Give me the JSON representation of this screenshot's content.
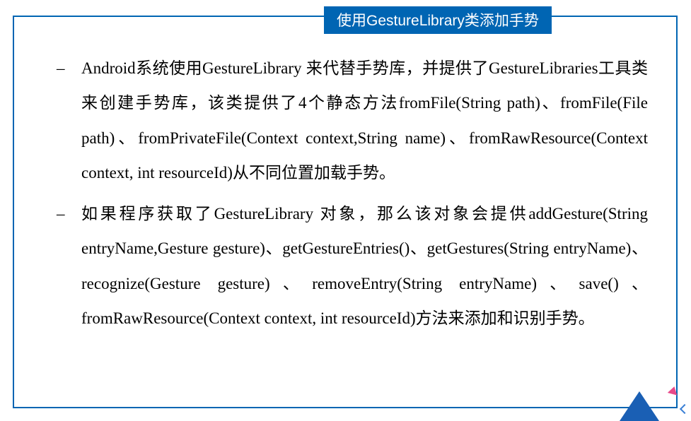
{
  "title": "使用GestureLibrary类添加手势",
  "bullets": [
    "Android系统使用GestureLibrary 来代替手势库，并提供了GestureLibraries工具类来创建手势库，该类提供了4个静态方法fromFile(String path)、fromFile(File path)、fromPrivateFile(Context context,String name)、fromRawResource(Context context, int resourceId)从不同位置加载手势。",
    "如果程序获取了GestureLibrary 对象，那么该对象会提供addGesture(String entryName,Gesture gesture)、getGestureEntries()、getGestures(String entryName)、recognize(Gesture gesture)、removeEntry(String entryName)、save()、fromRawResource(Context context, int resourceId)方法来添加和识别手势。"
  ],
  "colors": {
    "primary": "#0065b3",
    "accent_pink": "#e84a8a",
    "accent_blue": "#1a5fb4"
  }
}
